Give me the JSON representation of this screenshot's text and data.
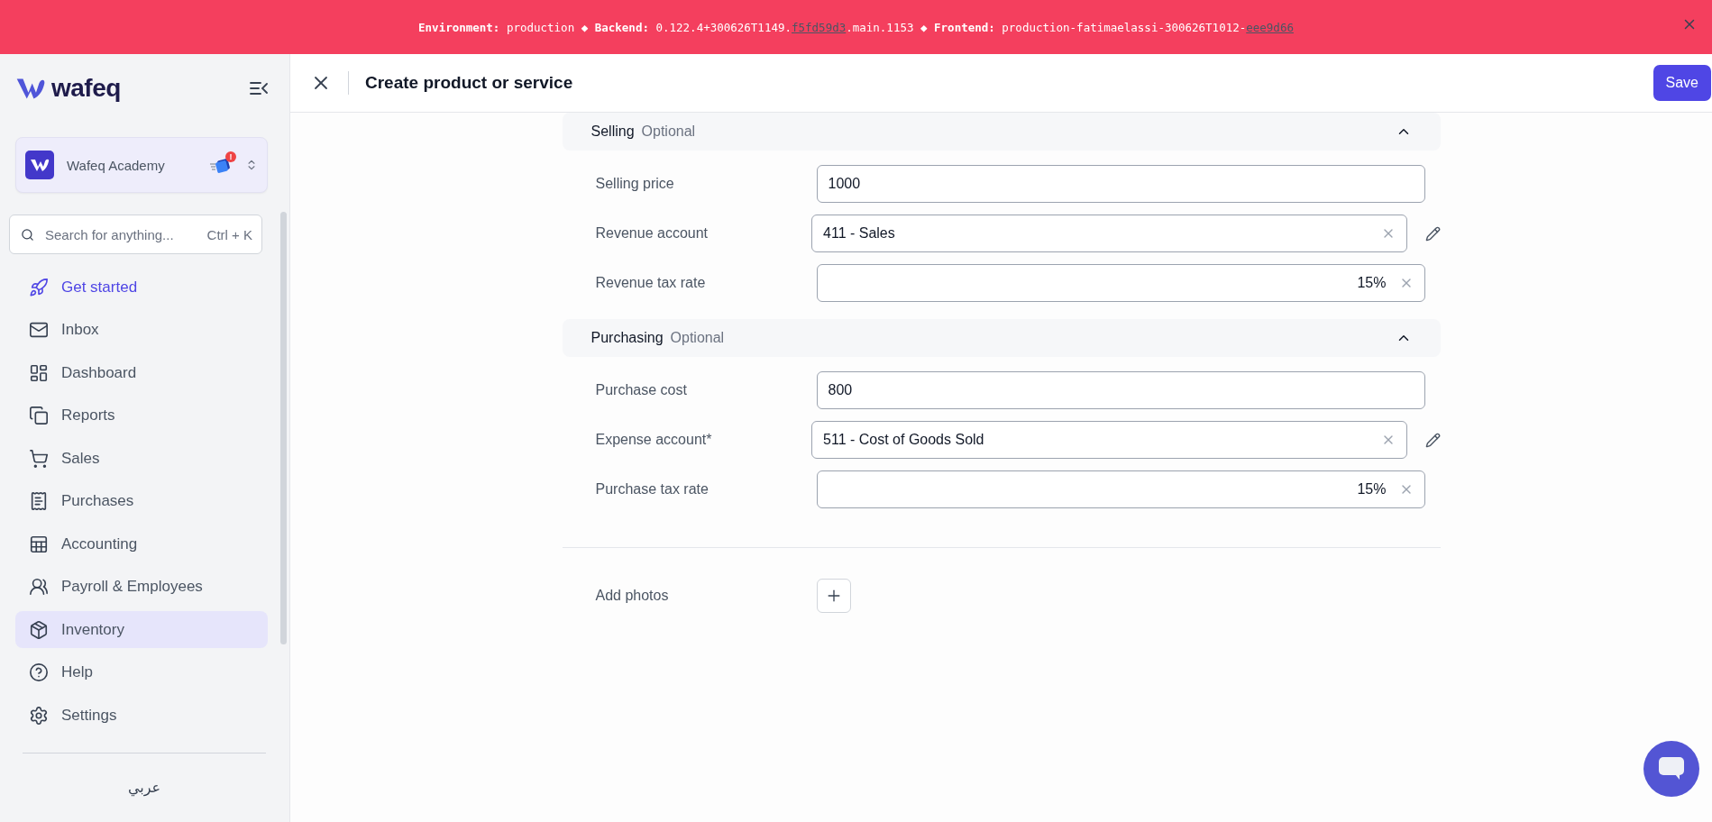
{
  "banner": {
    "parts": [
      {
        "kind": "text",
        "text": "**Environment:** production ◆ **Backend:** 0.122.4+300626T1149."
      },
      {
        "kind": "link",
        "text": "f5fd59d3"
      },
      {
        "kind": "text",
        "text": ".main.1153 ◆ **Frontend:** production-fatimaelassi-300626T1012-"
      },
      {
        "kind": "link",
        "text": "eee9d66"
      }
    ]
  },
  "sidebar": {
    "logo": "wafeq",
    "organization": {
      "name": "Wafeq Academy",
      "badge": "!"
    },
    "search": {
      "placeholder": "Search for anything...",
      "shortcut": "Ctrl + K"
    },
    "items": [
      {
        "kind": "rocket",
        "label": "Get started",
        "accent": true,
        "selected": false
      },
      {
        "kind": "inbox",
        "label": "Inbox",
        "accent": false,
        "selected": false
      },
      {
        "kind": "dashboard",
        "label": "Dashboard",
        "accent": false,
        "selected": false
      },
      {
        "kind": "reports",
        "label": "Reports",
        "accent": false,
        "selected": false
      },
      {
        "kind": "cart",
        "label": "Sales",
        "accent": false,
        "selected": false
      },
      {
        "kind": "receipt",
        "label": "Purchases",
        "accent": false,
        "selected": false
      },
      {
        "kind": "ledger",
        "label": "Accounting",
        "accent": false,
        "selected": false
      },
      {
        "kind": "people",
        "label": "Payroll & Employees",
        "accent": false,
        "selected": false
      },
      {
        "kind": "box",
        "label": "Inventory",
        "accent": false,
        "selected": true
      }
    ],
    "footer_items": [
      {
        "kind": "help",
        "label": "Help"
      },
      {
        "kind": "settings",
        "label": "Settings"
      }
    ],
    "language": "عربي"
  },
  "header": {
    "title": "Create product or service",
    "save": "Save"
  },
  "sections": [
    {
      "title": "Selling",
      "tag": "Optional",
      "expanded": true,
      "fields": [
        {
          "kind": "input",
          "label": "Selling price",
          "value": "1000",
          "editable": false
        },
        {
          "kind": "select",
          "label": "Revenue account",
          "value": "411 - Sales",
          "editable": true
        },
        {
          "kind": "rate",
          "label": "Revenue tax rate",
          "value": "15%",
          "editable": false
        }
      ]
    },
    {
      "title": "Purchasing",
      "tag": "Optional",
      "expanded": true,
      "fields": [
        {
          "kind": "input",
          "label": "Purchase cost",
          "value": "800",
          "editable": false
        },
        {
          "kind": "select",
          "label": "Expense account*",
          "value": "511 - Cost of Goods Sold",
          "editable": true
        },
        {
          "kind": "rate",
          "label": "Purchase tax rate",
          "value": "15%",
          "editable": false
        }
      ]
    }
  ],
  "photos": {
    "label": "Add photos"
  }
}
